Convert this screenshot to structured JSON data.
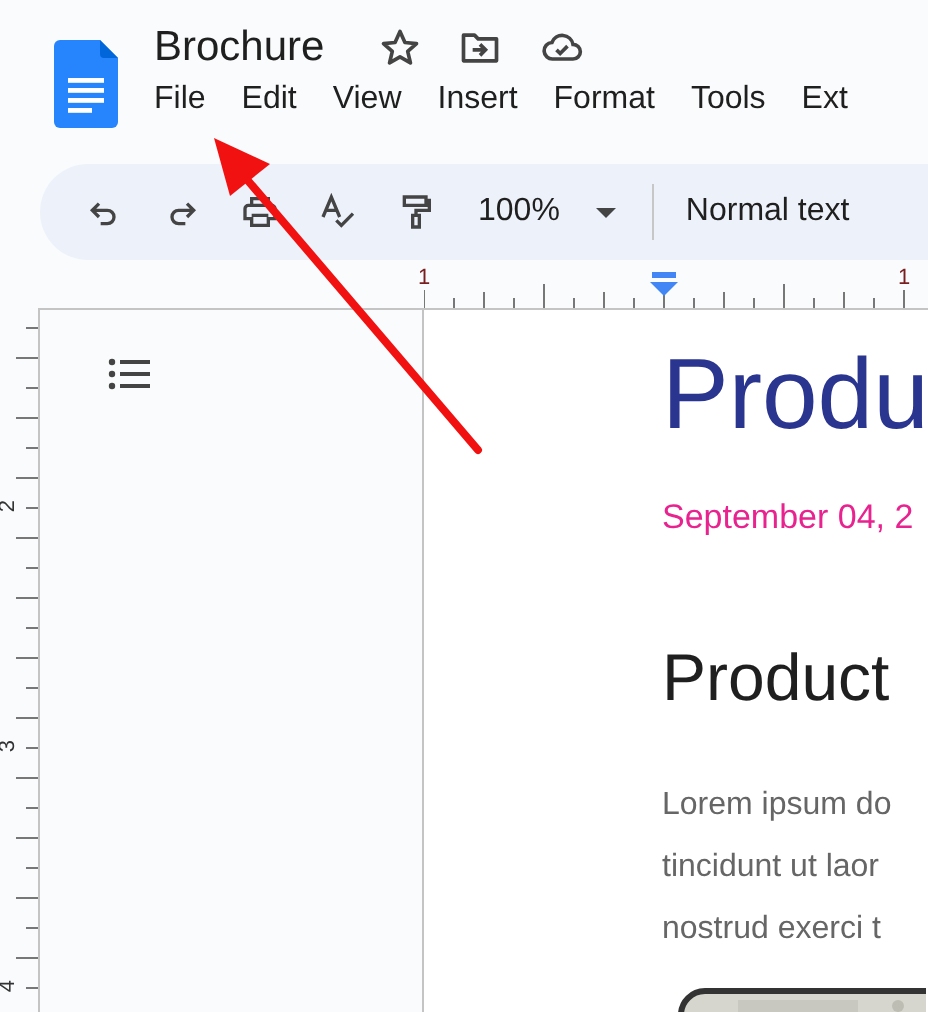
{
  "document": {
    "title": "Brochure"
  },
  "menu": [
    "File",
    "Edit",
    "View",
    "Insert",
    "Format",
    "Tools",
    "Ext"
  ],
  "toolbar": {
    "zoom": "100%",
    "style": "Normal text"
  },
  "ruler": {
    "top_labels": [
      "1",
      "1"
    ],
    "left_labels": [
      "2",
      "3",
      "4"
    ]
  },
  "page": {
    "title": "Produ",
    "date": "September 04, 2",
    "heading": "Product",
    "body": [
      "Lorem ipsum do",
      "tincidunt ut laor",
      "nostrud exerci t"
    ]
  }
}
